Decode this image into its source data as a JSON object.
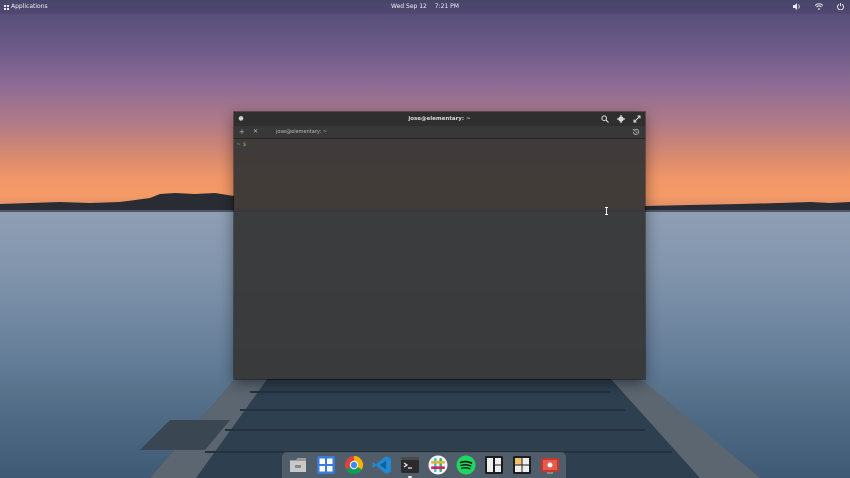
{
  "panel": {
    "applications_label": "Applications",
    "clock_date": "Wed Sep 12",
    "clock_time": "7:21 PM",
    "indicators": [
      "volume-icon",
      "network-icon",
      "power-icon"
    ]
  },
  "terminal": {
    "title": "jose@elementary: ~",
    "tab_label": "jose@elementary: ~",
    "prompt": "~ $"
  },
  "dock": {
    "apps": [
      {
        "name": "Files",
        "icon": "files-icon"
      },
      {
        "name": "AppCenter",
        "icon": "appcenter-icon"
      },
      {
        "name": "Google Chrome",
        "icon": "chrome-icon"
      },
      {
        "name": "Visual Studio Code",
        "icon": "vscode-icon"
      },
      {
        "name": "Terminal",
        "icon": "terminal-icon",
        "running": true
      },
      {
        "name": "Slack",
        "icon": "slack-icon"
      },
      {
        "name": "Spotify",
        "icon": "spotify-icon"
      },
      {
        "name": "Tiling",
        "icon": "tiling-icon"
      },
      {
        "name": "Boards",
        "icon": "boards-icon"
      },
      {
        "name": "Screen Recorder",
        "icon": "recorder-icon"
      }
    ]
  },
  "colors": {
    "window_bg": "#363636",
    "titlebar_bg": "#2f2f2f",
    "prompt_green": "#8bc34a"
  }
}
